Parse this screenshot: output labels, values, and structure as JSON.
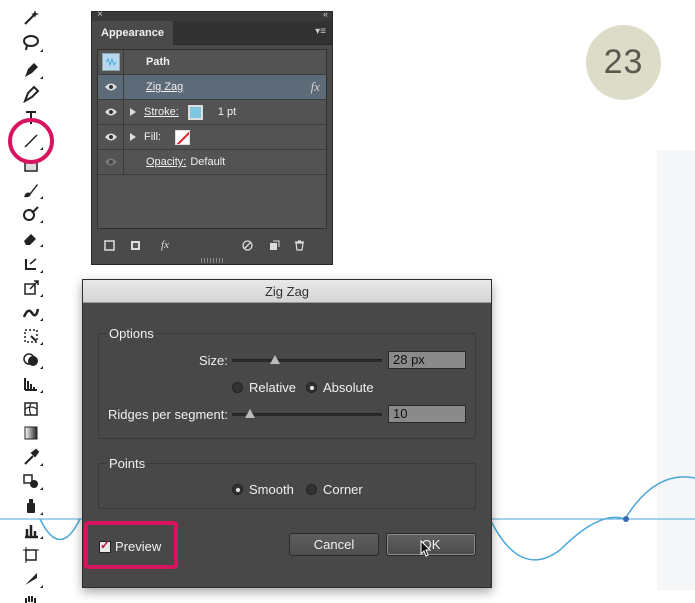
{
  "appearance_panel": {
    "tab_label": "Appearance",
    "rows": {
      "path": "Path",
      "effect": "Zig Zag",
      "stroke_label": "Stroke:",
      "stroke_weight": "1 pt",
      "fill_label": "Fill:",
      "opacity_label": "Opacity:",
      "opacity_value": "Default"
    },
    "fx_label": "fx",
    "bottom_fx": "fx"
  },
  "step_number": "23",
  "dialog": {
    "title": "Zig Zag",
    "options_group": "Options",
    "size_label": "Size:",
    "size_value": "28 px",
    "relative_label": "Relative",
    "absolute_label": "Absolute",
    "ridges_label": "Ridges per segment:",
    "ridges_value": "10",
    "points_group": "Points",
    "smooth_label": "Smooth",
    "corner_label": "Corner",
    "preview_label": "Preview",
    "cancel_label": "Cancel",
    "ok_label": "OK",
    "selected_type": "Absolute",
    "selected_points": "Smooth",
    "preview_checked": true
  },
  "colors": {
    "highlight": "#d6145f",
    "stroke_swatch": "#7dc8e0",
    "wave_line": "#4aa8d8"
  }
}
